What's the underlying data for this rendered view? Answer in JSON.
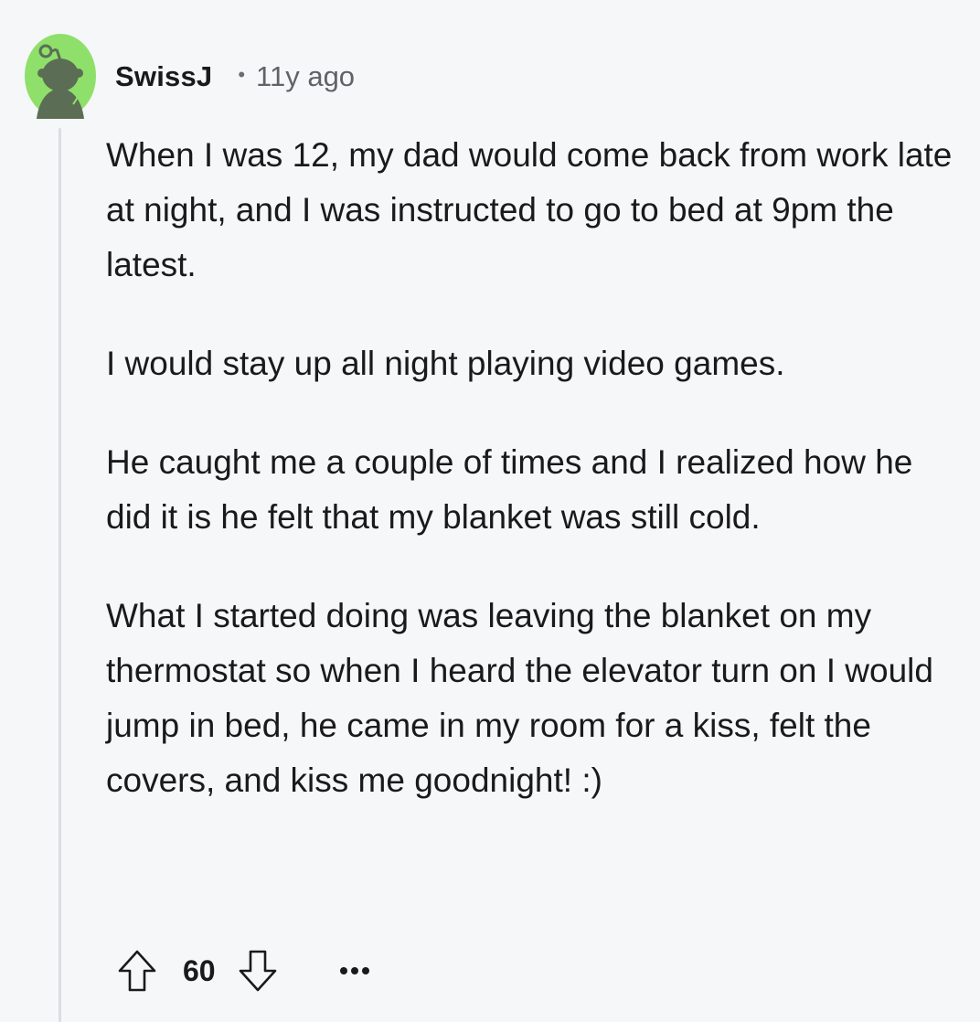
{
  "comment": {
    "author": "SwissJ",
    "separator": "•",
    "age": "11y ago",
    "paragraphs": [
      "When I was 12, my dad would come back from work late at night, and I was instructed to go to bed at 9pm the latest.",
      "I would stay up all night playing video games.",
      "He caught me a couple of times and I realized how he did it is he felt that my blanket was still cold.",
      "What I started doing was leaving the blanket on my thermostat so when I heard the elevator turn on I would jump in bed, he came in my room for a kiss, felt the covers, and kiss me goodnight! :)"
    ],
    "score": "60",
    "more_label": "•••"
  },
  "icons": {
    "avatar": "snoo-avatar-icon",
    "upvote": "upvote-arrow-icon",
    "downvote": "downvote-arrow-icon",
    "more": "more-options-icon"
  },
  "colors": {
    "avatar_bg": "#8fe06a",
    "avatar_figure": "#5b6e55",
    "background": "#f6f7f8",
    "thread_line": "#dadde1",
    "text": "#1a1a1b",
    "meta": "#5f6368"
  }
}
